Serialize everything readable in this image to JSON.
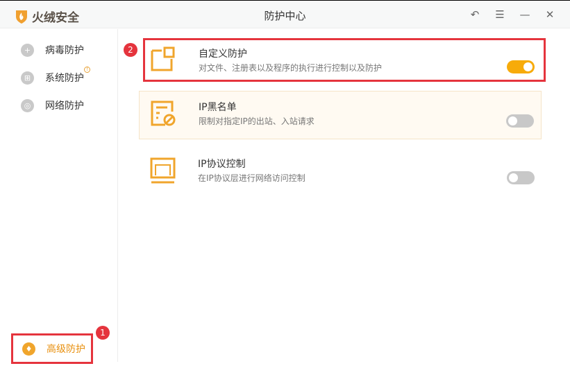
{
  "app": {
    "name": "火绒安全",
    "title": "防护中心"
  },
  "window_buttons": [
    {
      "name": "back",
      "glyph": "↶"
    },
    {
      "name": "menu",
      "glyph": "☰"
    },
    {
      "name": "minimize",
      "glyph": "—"
    },
    {
      "name": "close",
      "glyph": "✕"
    }
  ],
  "sidebar": {
    "items": [
      {
        "label": "病毒防护",
        "icon": "+"
      },
      {
        "label": "系统防护",
        "icon": "⊞",
        "warning": "!"
      },
      {
        "label": "网络防护",
        "icon": "◎"
      }
    ],
    "advanced": {
      "label": "高级防护",
      "icon": "♦"
    }
  },
  "badges": [
    "1",
    "2"
  ],
  "cards": [
    {
      "title": "自定义防护",
      "desc": "对文件、注册表以及程序的执行进行控制以及防护",
      "enabled": true
    },
    {
      "title": "IP黑名单",
      "desc": "限制对指定IP的出站、入站请求",
      "enabled": false
    },
    {
      "title": "IP协议控制",
      "desc": "在IP协议层进行网络访问控制",
      "enabled": false
    }
  ],
  "colors": {
    "accent": "#f7ab0a",
    "highlight": "#e5343d"
  }
}
